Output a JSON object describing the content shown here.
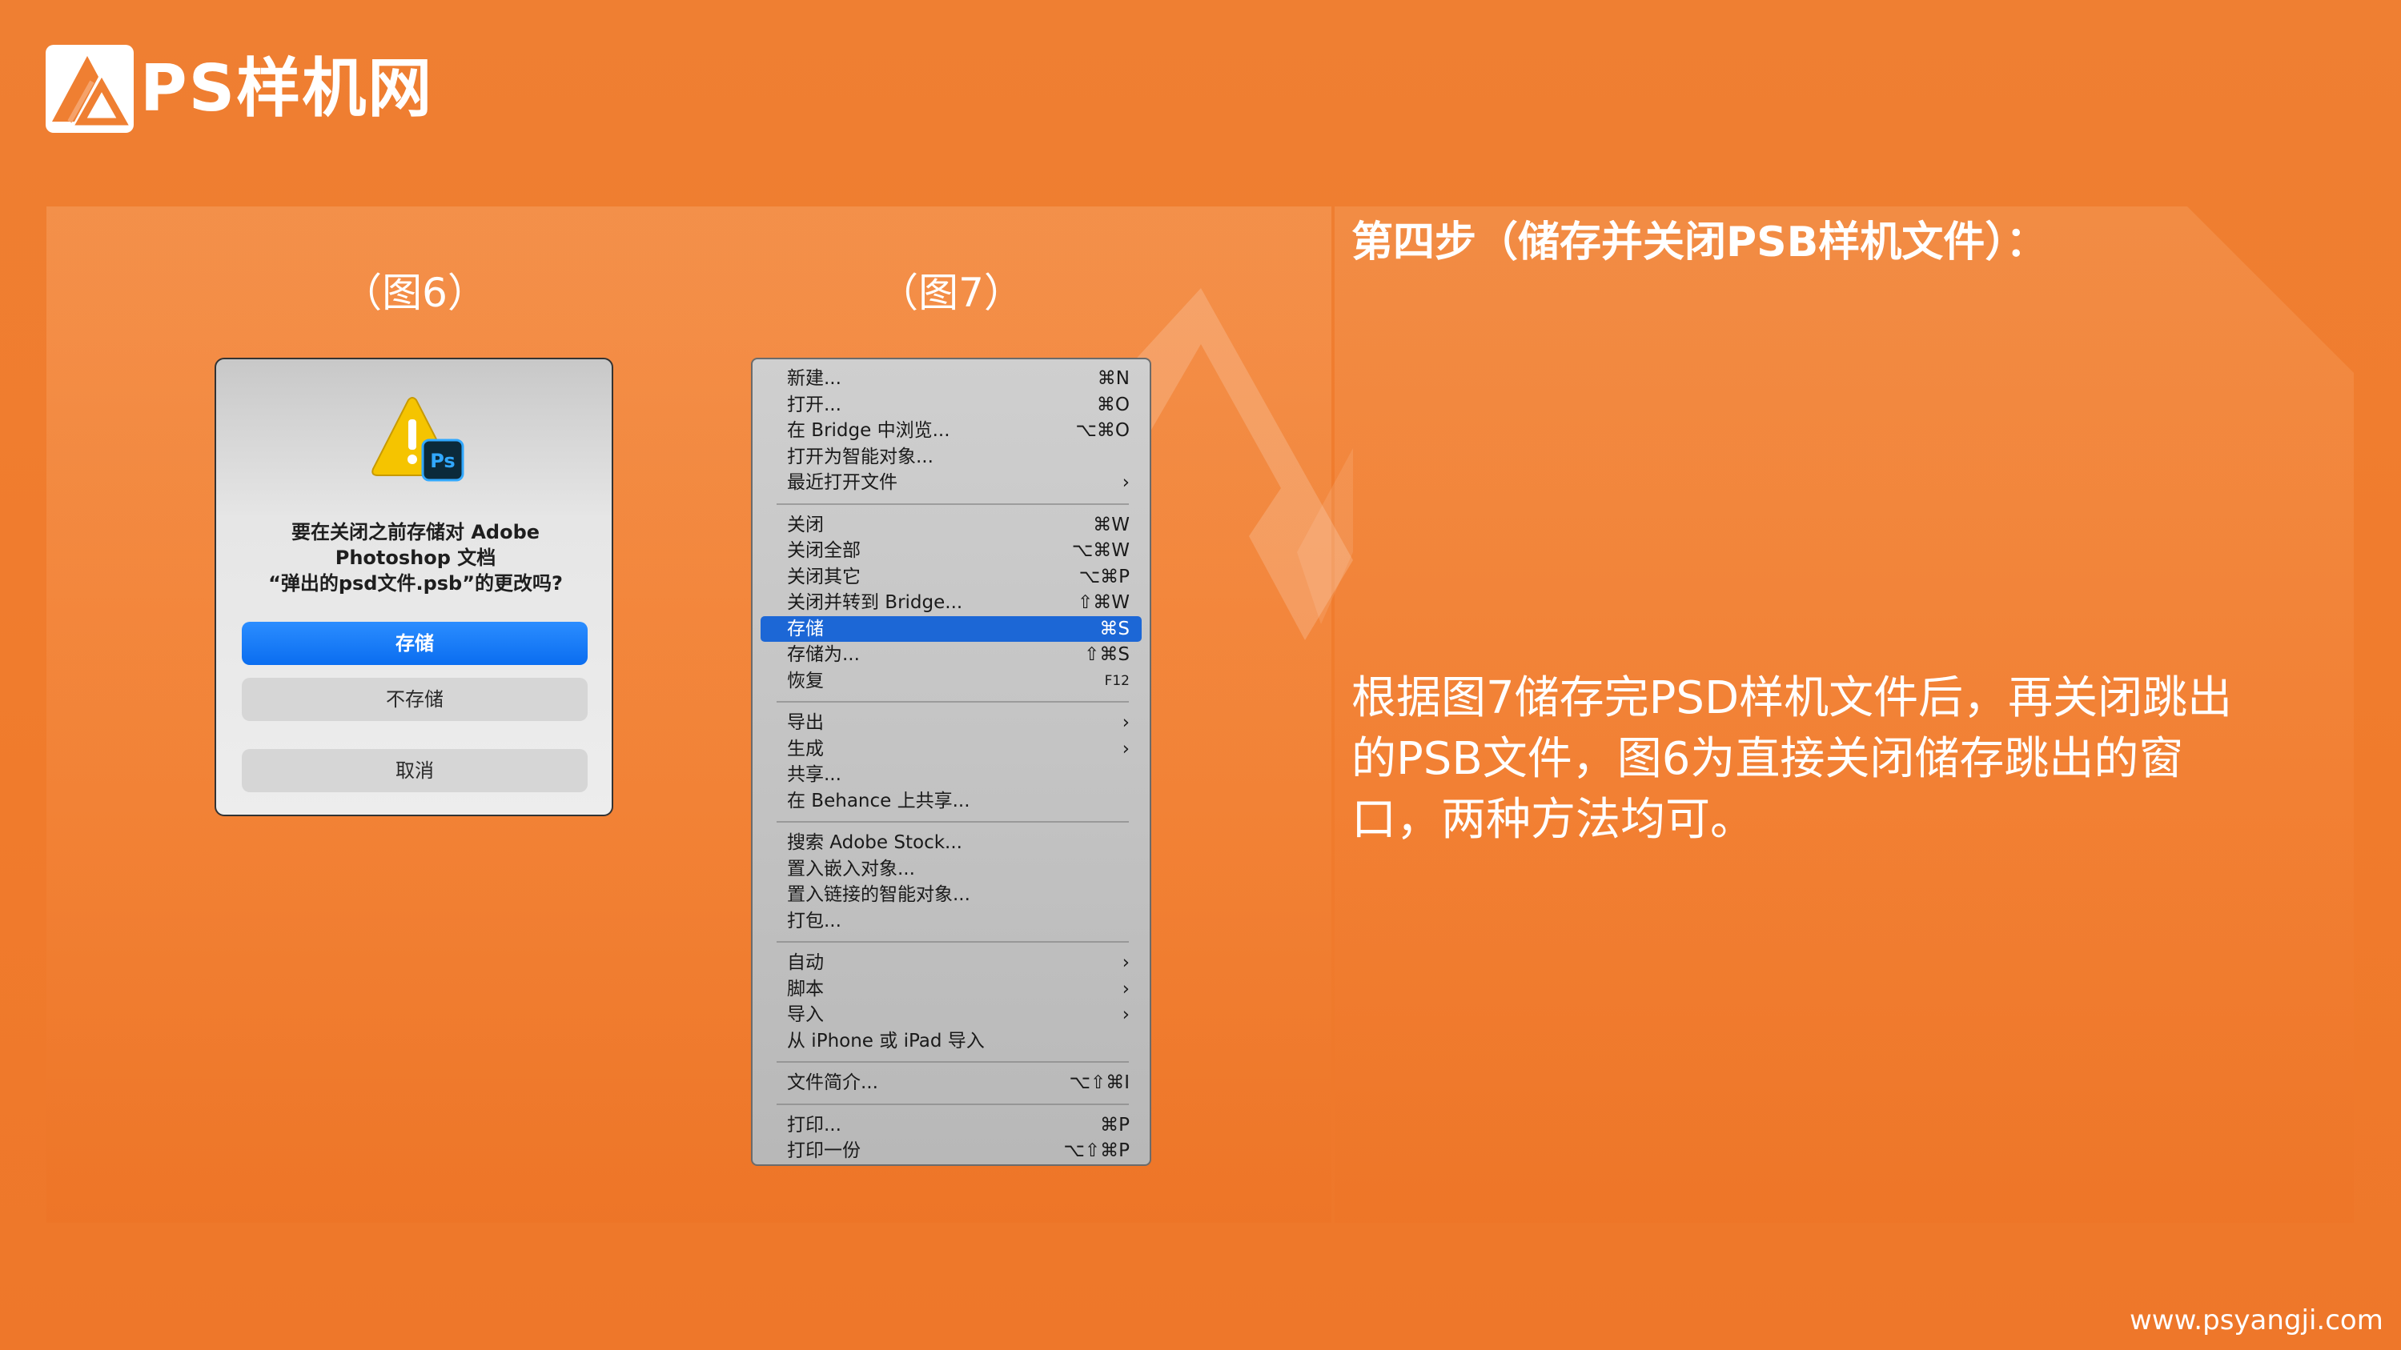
{
  "brand": {
    "name": "PS样机网"
  },
  "figures": {
    "fig6_label": "（图6）",
    "fig7_label": "（图7）"
  },
  "dialog": {
    "icon": "warning-photoshop-icon",
    "message_line1": "要在关闭之前存储对 Adobe",
    "message_line2": "Photoshop 文档",
    "message_line3": "“弹出的psd文件.psb”的更改吗?",
    "save": "存储",
    "dont_save": "不存储",
    "cancel": "取消"
  },
  "menu": {
    "groups": [
      [
        {
          "label": "新建...",
          "shortcut": "⌘N"
        },
        {
          "label": "打开...",
          "shortcut": "⌘O"
        },
        {
          "label": "在 Bridge 中浏览...",
          "shortcut": "⌥⌘O"
        },
        {
          "label": "打开为智能对象...",
          "shortcut": ""
        },
        {
          "label": "最近打开文件",
          "shortcut": "›"
        }
      ],
      [
        {
          "label": "关闭",
          "shortcut": "⌘W"
        },
        {
          "label": "关闭全部",
          "shortcut": "⌥⌘W"
        },
        {
          "label": "关闭其它",
          "shortcut": "⌥⌘P"
        },
        {
          "label": "关闭并转到 Bridge...",
          "shortcut": "⇧⌘W"
        },
        {
          "label": "存储",
          "shortcut": "⌘S",
          "selected": true
        },
        {
          "label": "存储为...",
          "shortcut": "⇧⌘S"
        },
        {
          "label": "恢复",
          "shortcut": "F12"
        }
      ],
      [
        {
          "label": "导出",
          "shortcut": "›"
        },
        {
          "label": "生成",
          "shortcut": "›"
        },
        {
          "label": "共享...",
          "shortcut": ""
        },
        {
          "label": "在 Behance 上共享...",
          "shortcut": ""
        }
      ],
      [
        {
          "label": "搜索 Adobe Stock...",
          "shortcut": ""
        },
        {
          "label": "置入嵌入对象...",
          "shortcut": ""
        },
        {
          "label": "置入链接的智能对象...",
          "shortcut": ""
        },
        {
          "label": "打包...",
          "shortcut": ""
        }
      ],
      [
        {
          "label": "自动",
          "shortcut": "›"
        },
        {
          "label": "脚本",
          "shortcut": "›"
        },
        {
          "label": "导入",
          "shortcut": "›"
        },
        {
          "label": "从 iPhone 或 iPad 导入",
          "shortcut": ""
        }
      ],
      [
        {
          "label": "文件简介...",
          "shortcut": "⌥⇧⌘I"
        }
      ],
      [
        {
          "label": "打印...",
          "shortcut": "⌘P"
        },
        {
          "label": "打印一份",
          "shortcut": "⌥⇧⌘P"
        }
      ]
    ]
  },
  "step": {
    "title": "第四步（储存并关闭PSB样机文件）：",
    "description": "根据图7储存完PSD样机文件后，再关闭跳出的PSB文件，图6为直接关闭储存跳出的窗口，两种方法均可。"
  },
  "footer": {
    "url": "www.psyangji.com"
  },
  "colors": {
    "accent_orange": "#ef7f32",
    "selection_blue": "#1c67d6",
    "button_blue": "#0a6df0"
  }
}
